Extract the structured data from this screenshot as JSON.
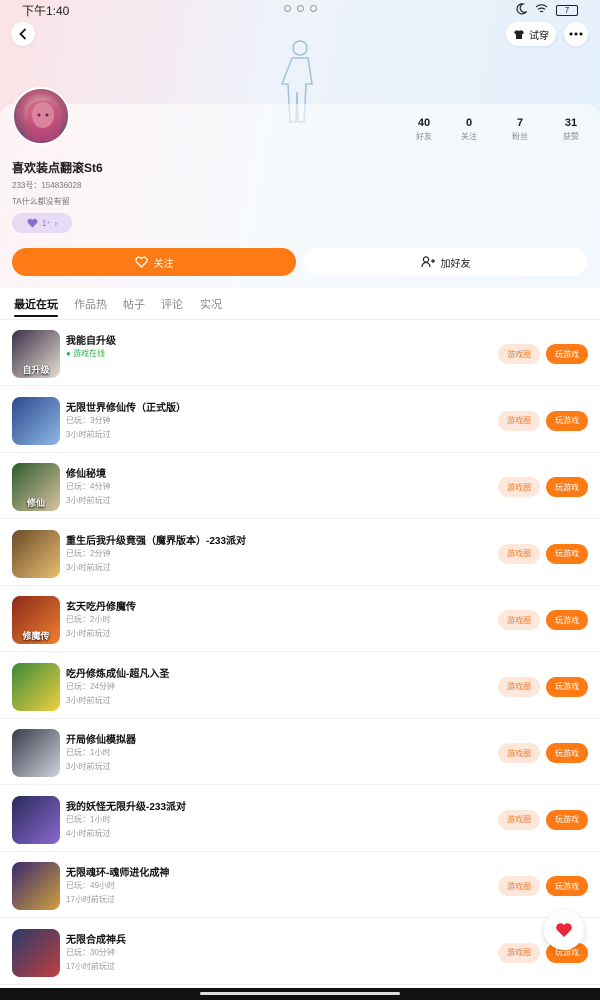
{
  "status": {
    "time": "下午1:40",
    "battery": "7"
  },
  "header": {
    "dress_label": "试穿"
  },
  "profile": {
    "nickname": "喜欢装点翻滚St6",
    "uid": "233号：154836028",
    "bio": "TA什么都没有留",
    "badge_text": "1⁺",
    "stats": [
      {
        "num": "40",
        "label": "好友"
      },
      {
        "num": "0",
        "label": "关注"
      },
      {
        "num": "7",
        "label": "粉丝"
      },
      {
        "num": "31",
        "label": "获赞"
      }
    ]
  },
  "actions": {
    "follow": "关注",
    "add_friend": "加好友"
  },
  "tabs": [
    {
      "label": "最近在玩"
    },
    {
      "label": "作品热"
    },
    {
      "label": "帖子"
    },
    {
      "label": "评论"
    },
    {
      "label": "实况"
    }
  ],
  "games": [
    {
      "title": "我能自升级",
      "online": "● 游戏在线",
      "sub1": "",
      "sub2": "",
      "thumb_text": "自升级",
      "colors": [
        "#3a2f4a",
        "#e8e0d0"
      ]
    },
    {
      "title": "无限世界修仙传（正式版）",
      "sub1": "已玩：3分钟",
      "sub2": "3小时前玩过",
      "thumb_text": "",
      "colors": [
        "#2b4a8a",
        "#8fb8e8"
      ]
    },
    {
      "title": "修仙秘境",
      "sub1": "已玩：4分钟",
      "sub2": "3小时前玩过",
      "thumb_text": "修仙",
      "colors": [
        "#2e5a2a",
        "#d8c4a4"
      ]
    },
    {
      "title": "重生后我升级竟强（魔界版本）-233派对",
      "sub1": "已玩：2分钟",
      "sub2": "3小时前玩过",
      "thumb_text": "",
      "colors": [
        "#6a4a2a",
        "#e8c070"
      ]
    },
    {
      "title": "玄天吃丹修魔传",
      "sub1": "已玩：2小时",
      "sub2": "3小时前玩过",
      "thumb_text": "修魔传",
      "colors": [
        "#8a2a1a",
        "#f08030"
      ]
    },
    {
      "title": "吃丹修炼成仙-超凡入圣",
      "sub1": "已玩：24分钟",
      "sub2": "3小时前玩过",
      "thumb_text": "",
      "colors": [
        "#3a8a3a",
        "#f0d040"
      ]
    },
    {
      "title": "开局修仙模拟器",
      "sub1": "已玩：1小时",
      "sub2": "3小时前玩过",
      "thumb_text": "",
      "colors": [
        "#3a3a4a",
        "#d0d4dc"
      ]
    },
    {
      "title": "我的妖怪无限升级-233派对",
      "sub1": "已玩：1小时",
      "sub2": "4小时前玩过",
      "thumb_text": "",
      "colors": [
        "#2a2a5a",
        "#8a6ad0"
      ]
    },
    {
      "title": "无限魂环-魂师进化成神",
      "sub1": "已玩：49小时",
      "sub2": "17小时前玩过",
      "thumb_text": "",
      "colors": [
        "#3a2a6a",
        "#d0a040"
      ]
    },
    {
      "title": "无限合成神兵",
      "sub1": "已玩：30分钟",
      "sub2": "17小时前玩过",
      "thumb_text": "",
      "colors": [
        "#2a3a6a",
        "#c04040"
      ]
    }
  ],
  "row_buttons": {
    "circle": "游戏圈",
    "play": "玩游戏"
  }
}
